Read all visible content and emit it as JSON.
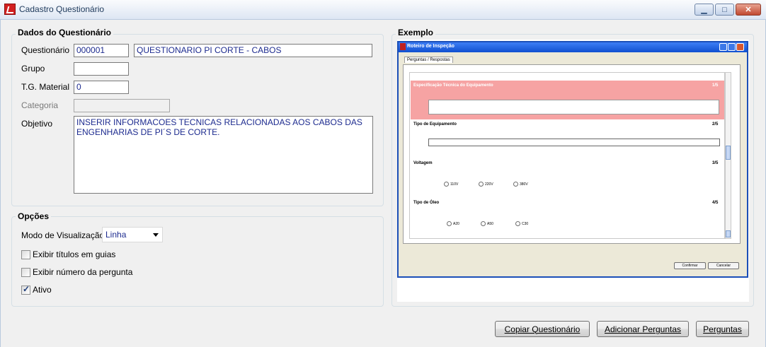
{
  "window": {
    "title": "Cadastro Questionário",
    "controls": {
      "minimize": "▁",
      "maximize": "□",
      "close": "✕"
    }
  },
  "dados": {
    "legend": "Dados do Questionário",
    "questionario_label": "Questionário",
    "questionario_code": "000001",
    "questionario_name": "QUESTIONARIO PI CORTE - CABOS",
    "grupo_label": "Grupo",
    "grupo_value": "",
    "tg_label": "T.G. Material",
    "tg_value": "0",
    "categoria_label": "Categoria",
    "categoria_value": "",
    "objetivo_label": "Objetivo",
    "objetivo_value": "INSERIR INFORMACOES TECNICAS RELACIONADAS AOS CABOS DAS ENGENHARIAS DE PI´S DE CORTE."
  },
  "opcoes": {
    "legend": "Opções",
    "modo_label": "Modo de Visualização",
    "modo_value": "Linha",
    "exibir_titulos": {
      "label": "Exibir títulos em guias",
      "checked": false
    },
    "exibir_numero": {
      "label": "Exibir número da pergunta",
      "checked": false
    },
    "ativo": {
      "label": "Ativo",
      "checked": true
    }
  },
  "exemplo": {
    "legend": "Exemplo",
    "window_title": "Roteiro de Inspeção",
    "tab": "Perguntas / Respostas",
    "questions": [
      {
        "title": "Especificação Técnica do Equipamento",
        "num": "1/5"
      },
      {
        "title": "Tipo de Equipamento",
        "num": "2/5"
      },
      {
        "title": "Voltagem",
        "num": "3/5",
        "options": [
          "110V",
          "220V",
          "380V"
        ]
      },
      {
        "title": "Tipo de Óleo",
        "num": "4/5",
        "options": [
          "A20",
          "A50",
          "C30"
        ]
      }
    ],
    "confirm": "Confirmar",
    "cancel": "Cancelar"
  },
  "buttons": {
    "copiar": "Copiar Questionário",
    "adicionar": "Adicionar Perguntas",
    "perguntas": "Perguntas"
  },
  "colors": {
    "highlight_row": "#f6a3a3",
    "field_text": "#1d2b8f",
    "preview_title": "#1050d0"
  }
}
